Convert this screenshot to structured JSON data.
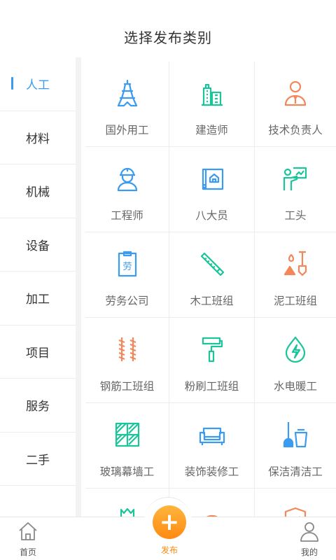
{
  "header": {
    "title": "选择发布类别"
  },
  "sidebar": {
    "items": [
      {
        "label": "人工"
      },
      {
        "label": "材料"
      },
      {
        "label": "机械"
      },
      {
        "label": "设备"
      },
      {
        "label": "加工"
      },
      {
        "label": "项目"
      },
      {
        "label": "服务"
      },
      {
        "label": "二手"
      },
      {
        "label": ""
      }
    ],
    "active_index": 0,
    "active_color": "#3b9bf0"
  },
  "grid": {
    "items": [
      {
        "label": "国外用工",
        "icon": "eiffel-tower-icon"
      },
      {
        "label": "建造师",
        "icon": "buildings-icon"
      },
      {
        "label": "技术负责人",
        "icon": "manager-icon"
      },
      {
        "label": "工程师",
        "icon": "engineer-helmet-icon"
      },
      {
        "label": "八大员",
        "icon": "blueprint-icon"
      },
      {
        "label": "工头",
        "icon": "foreman-icon"
      },
      {
        "label": "劳务公司",
        "icon": "labor-clipboard-icon"
      },
      {
        "label": "木工班组",
        "icon": "saw-icon"
      },
      {
        "label": "泥工班组",
        "icon": "shovel-icon"
      },
      {
        "label": "钢筋工班组",
        "icon": "rebar-icon"
      },
      {
        "label": "粉刷工班组",
        "icon": "paint-roller-icon"
      },
      {
        "label": "水电暖工",
        "icon": "electric-drop-icon"
      },
      {
        "label": "玻璃幕墙工",
        "icon": "glass-wall-icon"
      },
      {
        "label": "装饰装修工",
        "icon": "sofa-icon"
      },
      {
        "label": "保洁清洁工",
        "icon": "mop-bucket-icon"
      },
      {
        "label": "",
        "icon": "flower-icon"
      },
      {
        "label": "",
        "icon": "arch-icon"
      },
      {
        "label": "",
        "icon": "shield-icon"
      }
    ]
  },
  "tabbar": {
    "home_label": "首页",
    "publish_label": "发布",
    "mine_label": "我的",
    "publish_color": "#ff8a12"
  }
}
